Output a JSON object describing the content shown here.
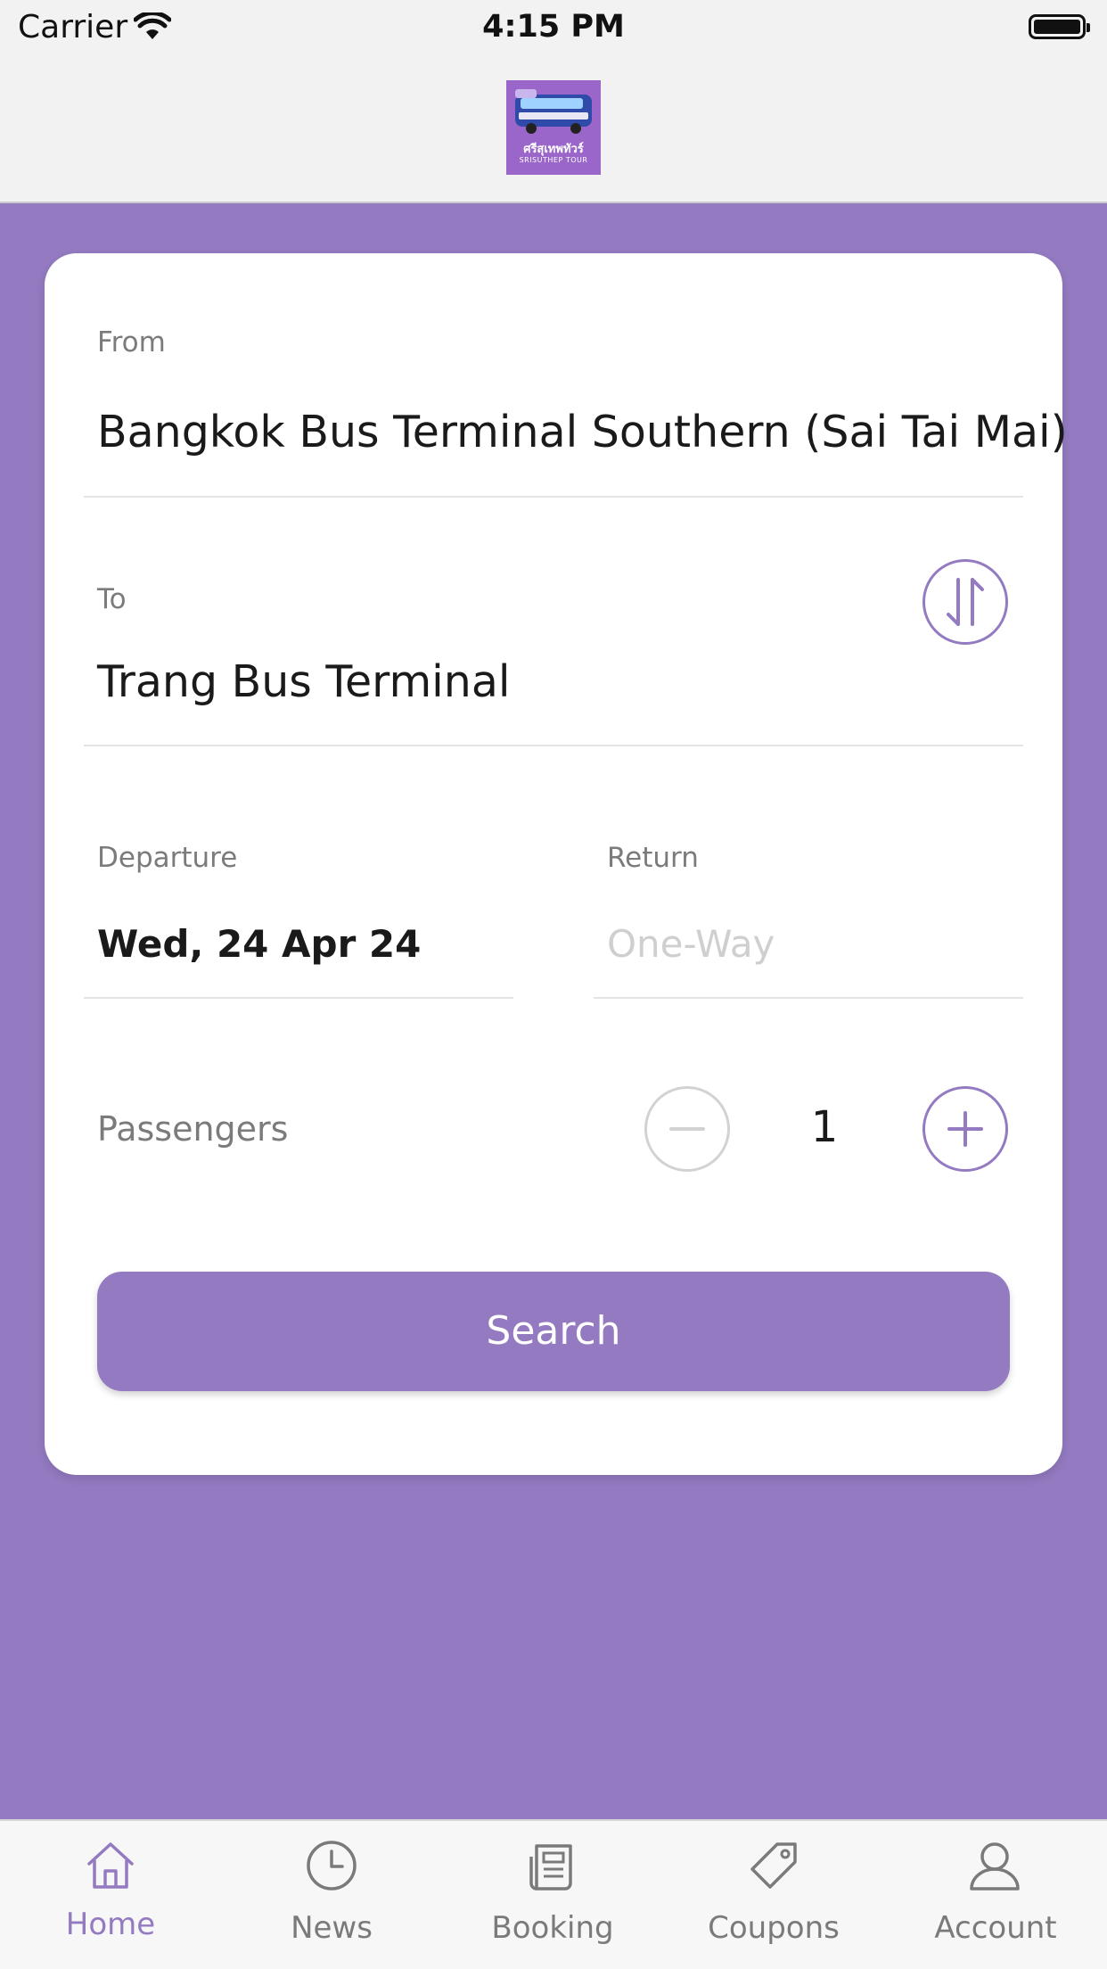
{
  "status_bar": {
    "carrier": "Carrier",
    "time": "4:15 PM"
  },
  "header": {
    "logo_name": "ศรีสุเทพทัวร์",
    "logo_subtitle": "SRISUTHEP TOUR"
  },
  "form": {
    "from": {
      "label": "From",
      "value": "Bangkok Bus Terminal Southern (Sai Tai Mai)"
    },
    "to": {
      "label": "To",
      "value": "Trang Bus Terminal"
    },
    "departure": {
      "label": "Departure",
      "value": "Wed, 24 Apr 24"
    },
    "return": {
      "label": "Return",
      "value": "One-Way"
    },
    "passengers": {
      "label": "Passengers",
      "count": "1"
    },
    "search_label": "Search"
  },
  "tabs": [
    {
      "label": "Home",
      "icon": "home-icon",
      "active": true
    },
    {
      "label": "News",
      "icon": "clock-icon",
      "active": false
    },
    {
      "label": "Booking",
      "icon": "document-icon",
      "active": false
    },
    {
      "label": "Coupons",
      "icon": "tag-icon",
      "active": false
    },
    {
      "label": "Account",
      "icon": "user-icon",
      "active": false
    }
  ],
  "colors": {
    "accent": "#937ac1",
    "background": "#937ac1",
    "card": "#ffffff",
    "placeholder": "#cfcfcf",
    "disabled": "#d2d2d2"
  }
}
